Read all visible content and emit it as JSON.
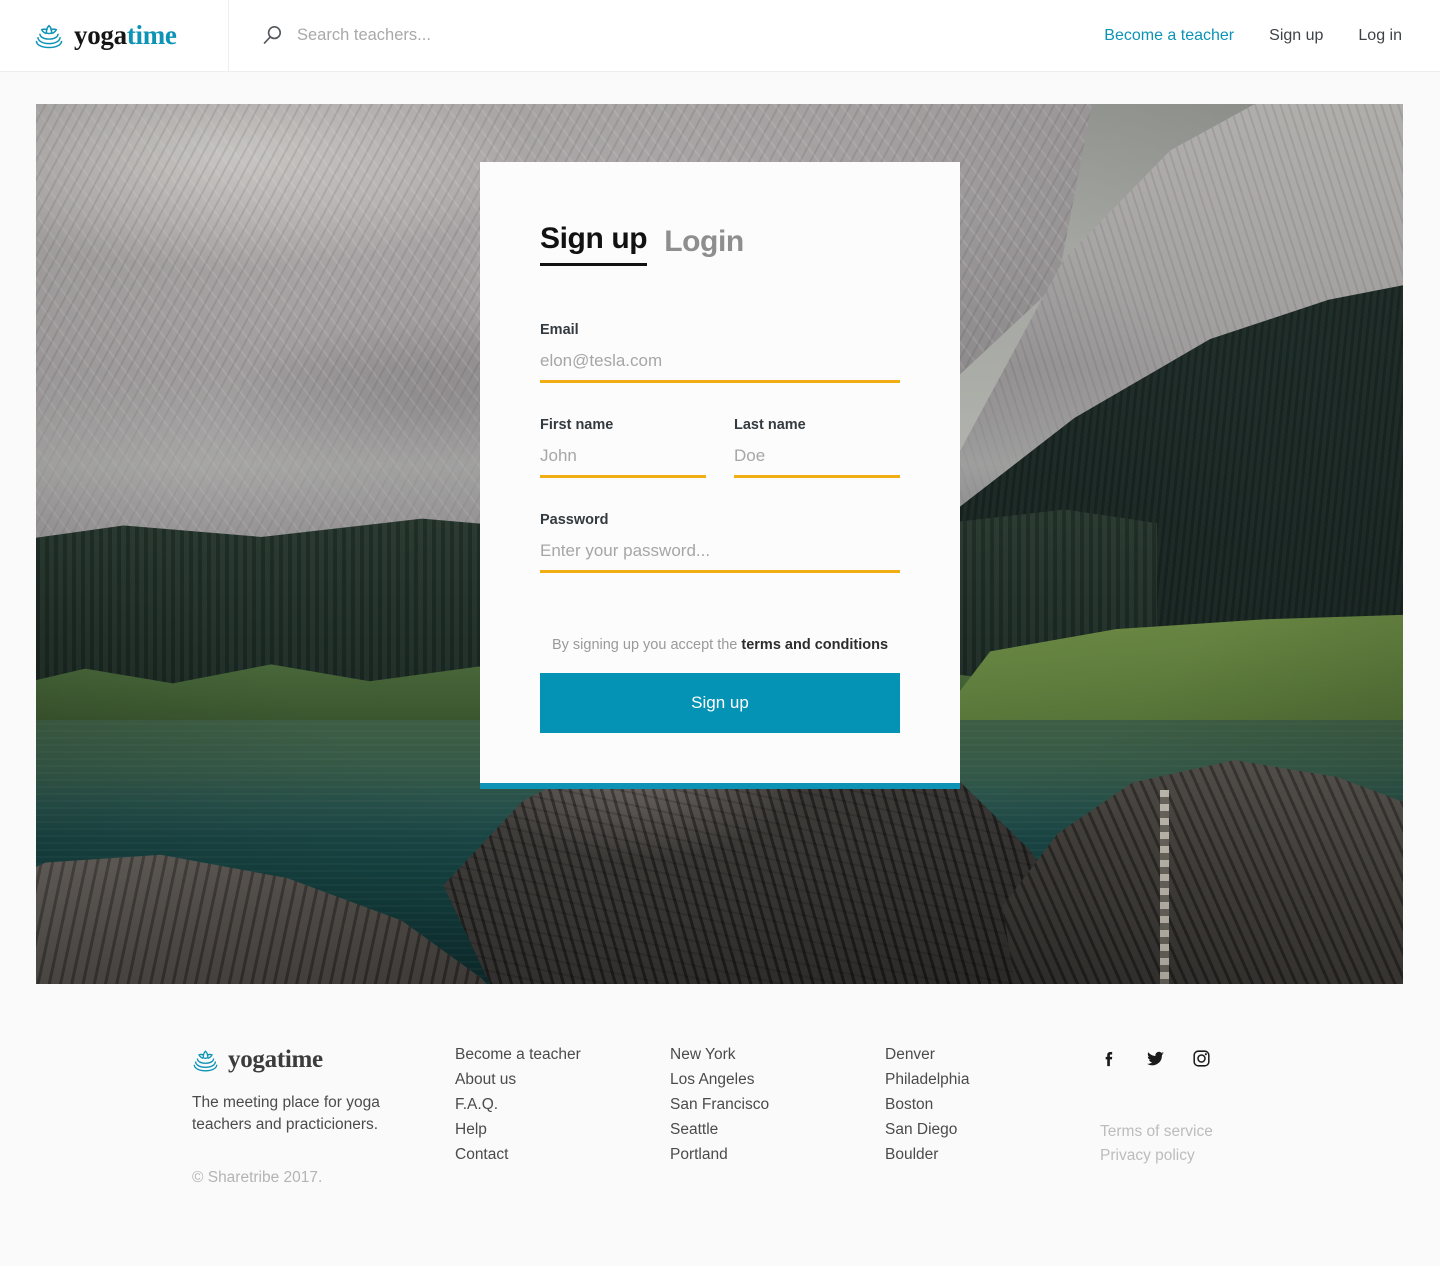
{
  "header": {
    "logo": {
      "icon": "lotus-icon",
      "text_primary": "yoga",
      "text_accent": "time"
    },
    "search": {
      "icon": "search-icon",
      "placeholder": "Search teachers...",
      "value": ""
    },
    "nav": [
      {
        "label": "Become a teacher",
        "accent": true
      },
      {
        "label": "Sign up",
        "accent": false
      },
      {
        "label": "Log in",
        "accent": false
      }
    ]
  },
  "auth_card": {
    "tabs": [
      {
        "label": "Sign up",
        "active": true
      },
      {
        "label": "Login",
        "active": false
      }
    ],
    "fields": {
      "email": {
        "label": "Email",
        "placeholder": "elon@tesla.com",
        "value": ""
      },
      "first_name": {
        "label": "First name",
        "placeholder": "John",
        "value": ""
      },
      "last_name": {
        "label": "Last name",
        "placeholder": "Doe",
        "value": ""
      },
      "password": {
        "label": "Password",
        "placeholder": "Enter your password...",
        "value": ""
      }
    },
    "terms_prefix": "By signing up you accept the ",
    "terms_link": "terms and conditions",
    "submit_label": "Sign up"
  },
  "footer": {
    "logo": {
      "icon": "lotus-icon",
      "text_primary": "yoga",
      "text_accent": "time"
    },
    "tagline": "The meeting place for yoga teachers and practicioners.",
    "copyright": "© Sharetribe 2017.",
    "columns": [
      {
        "items": [
          "Become a teacher",
          "About us",
          "F.A.Q.",
          "Help",
          "Contact"
        ]
      },
      {
        "items": [
          "New York",
          "Los Angeles",
          "San Francisco",
          "Seattle",
          "Portland"
        ]
      },
      {
        "items": [
          "Denver",
          "Philadelphia",
          "Boston",
          "San Diego",
          "Boulder"
        ]
      }
    ],
    "socials": [
      "facebook-icon",
      "twitter-icon",
      "instagram-icon"
    ],
    "legal": [
      "Terms of service",
      "Privacy policy"
    ]
  },
  "colors": {
    "accent_teal": "#0c93b5",
    "button_teal": "#0593b5",
    "underline_amber": "#f0ad14",
    "page_bg": "#fafafa",
    "card_bg": "#fcfcfc"
  }
}
